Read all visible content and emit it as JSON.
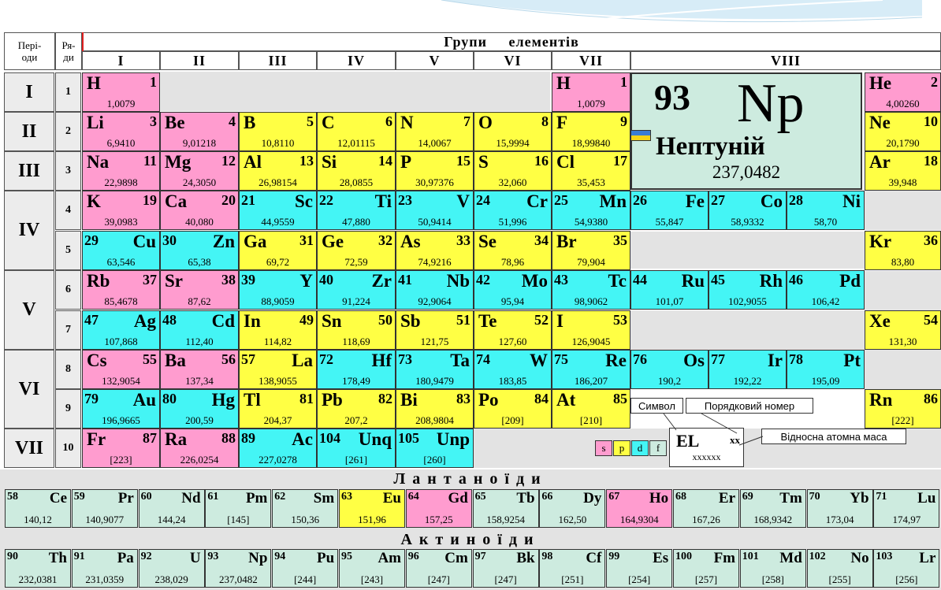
{
  "header": {
    "periods_label": "Пері-\nоди",
    "rows_label": "Ря-\nди",
    "groups_title": "Групи     елементів",
    "groups": [
      "I",
      "II",
      "III",
      "IV",
      "V",
      "VI",
      "VII",
      "VIII"
    ]
  },
  "periods": [
    "I",
    "II",
    "III",
    "IV",
    "V",
    "VI",
    "VII"
  ],
  "rows": [
    "1",
    "2",
    "3",
    "4",
    "5",
    "6",
    "7",
    "8",
    "9",
    "10"
  ],
  "elements": [
    {
      "sym": "H",
      "num": "1",
      "mass": "1,0079",
      "block": "s",
      "col": 1,
      "row": 1,
      "lay": "a"
    },
    {
      "sym": "H",
      "num": "1",
      "mass": "1,0079",
      "block": "s",
      "col": 7,
      "row": 1,
      "lay": "a"
    },
    {
      "sym": "He",
      "num": "2",
      "mass": "4,00260",
      "block": "s",
      "col": 9,
      "row": 1,
      "lay": "a"
    },
    {
      "sym": "Li",
      "num": "3",
      "mass": "6,9410",
      "block": "s",
      "col": 1,
      "row": 2,
      "lay": "a"
    },
    {
      "sym": "Be",
      "num": "4",
      "mass": "9,01218",
      "block": "s",
      "col": 2,
      "row": 2,
      "lay": "a"
    },
    {
      "sym": "B",
      "num": "5",
      "mass": "10,8110",
      "block": "p",
      "col": 3,
      "row": 2,
      "lay": "a"
    },
    {
      "sym": "C",
      "num": "6",
      "mass": "12,01115",
      "block": "p",
      "col": 4,
      "row": 2,
      "lay": "a"
    },
    {
      "sym": "N",
      "num": "7",
      "mass": "14,0067",
      "block": "p",
      "col": 5,
      "row": 2,
      "lay": "a"
    },
    {
      "sym": "O",
      "num": "8",
      "mass": "15,9994",
      "block": "p",
      "col": 6,
      "row": 2,
      "lay": "a"
    },
    {
      "sym": "F",
      "num": "9",
      "mass": "18,99840",
      "block": "p",
      "col": 7,
      "row": 2,
      "lay": "a"
    },
    {
      "sym": "Ne",
      "num": "10",
      "mass": "20,1790",
      "block": "p",
      "col": 9,
      "row": 2,
      "lay": "a"
    },
    {
      "sym": "Na",
      "num": "11",
      "mass": "22,9898",
      "block": "s",
      "col": 1,
      "row": 3,
      "lay": "a"
    },
    {
      "sym": "Mg",
      "num": "12",
      "mass": "24,3050",
      "block": "s",
      "col": 2,
      "row": 3,
      "lay": "a"
    },
    {
      "sym": "Al",
      "num": "13",
      "mass": "26,98154",
      "block": "p",
      "col": 3,
      "row": 3,
      "lay": "a"
    },
    {
      "sym": "Si",
      "num": "14",
      "mass": "28,0855",
      "block": "p",
      "col": 4,
      "row": 3,
      "lay": "a"
    },
    {
      "sym": "P",
      "num": "15",
      "mass": "30,97376",
      "block": "p",
      "col": 5,
      "row": 3,
      "lay": "a"
    },
    {
      "sym": "S",
      "num": "16",
      "mass": "32,060",
      "block": "p",
      "col": 6,
      "row": 3,
      "lay": "a"
    },
    {
      "sym": "Cl",
      "num": "17",
      "mass": "35,453",
      "block": "p",
      "col": 7,
      "row": 3,
      "lay": "a"
    },
    {
      "sym": "Ar",
      "num": "18",
      "mass": "39,948",
      "block": "p",
      "col": 9,
      "row": 3,
      "lay": "a"
    },
    {
      "sym": "K",
      "num": "19",
      "mass": "39,0983",
      "block": "s",
      "col": 1,
      "row": 4,
      "lay": "a"
    },
    {
      "sym": "Ca",
      "num": "20",
      "mass": "40,080",
      "block": "s",
      "col": 2,
      "row": 4,
      "lay": "a"
    },
    {
      "sym": "Sc",
      "num": "21",
      "mass": "44,9559",
      "block": "d",
      "col": 3,
      "row": 4,
      "lay": "b"
    },
    {
      "sym": "Ti",
      "num": "22",
      "mass": "47,880",
      "block": "d",
      "col": 4,
      "row": 4,
      "lay": "b"
    },
    {
      "sym": "V",
      "num": "23",
      "mass": "50,9414",
      "block": "d",
      "col": 5,
      "row": 4,
      "lay": "b"
    },
    {
      "sym": "Cr",
      "num": "24",
      "mass": "51,996",
      "block": "d",
      "col": 6,
      "row": 4,
      "lay": "b"
    },
    {
      "sym": "Mn",
      "num": "25",
      "mass": "54,9380",
      "block": "d",
      "col": 7,
      "row": 4,
      "lay": "b"
    },
    {
      "sym": "Fe",
      "num": "26",
      "mass": "55,847",
      "block": "d",
      "col": 8,
      "row": 4,
      "lay": "b"
    },
    {
      "sym": "Co",
      "num": "27",
      "mass": "58,9332",
      "block": "d",
      "col": 8.5,
      "row": 4,
      "lay": "b"
    },
    {
      "sym": "Ni",
      "num": "28",
      "mass": "58,70",
      "block": "d",
      "col": 8.75,
      "row": 4,
      "lay": "b"
    },
    {
      "sym": "Cu",
      "num": "29",
      "mass": "63,546",
      "block": "d",
      "col": 1,
      "row": 5,
      "lay": "b"
    },
    {
      "sym": "Zn",
      "num": "30",
      "mass": "65,38",
      "block": "d",
      "col": 2,
      "row": 5,
      "lay": "b"
    },
    {
      "sym": "Ga",
      "num": "31",
      "mass": "69,72",
      "block": "p",
      "col": 3,
      "row": 5,
      "lay": "a"
    },
    {
      "sym": "Ge",
      "num": "32",
      "mass": "72,59",
      "block": "p",
      "col": 4,
      "row": 5,
      "lay": "a"
    },
    {
      "sym": "As",
      "num": "33",
      "mass": "74,9216",
      "block": "p",
      "col": 5,
      "row": 5,
      "lay": "a"
    },
    {
      "sym": "Se",
      "num": "34",
      "mass": "78,96",
      "block": "p",
      "col": 6,
      "row": 5,
      "lay": "a"
    },
    {
      "sym": "Br",
      "num": "35",
      "mass": "79,904",
      "block": "p",
      "col": 7,
      "row": 5,
      "lay": "a"
    },
    {
      "sym": "Kr",
      "num": "36",
      "mass": "83,80",
      "block": "p",
      "col": 9,
      "row": 5,
      "lay": "a"
    },
    {
      "sym": "Rb",
      "num": "37",
      "mass": "85,4678",
      "block": "s",
      "col": 1,
      "row": 6,
      "lay": "a"
    },
    {
      "sym": "Sr",
      "num": "38",
      "mass": "87,62",
      "block": "s",
      "col": 2,
      "row": 6,
      "lay": "a"
    },
    {
      "sym": "Y",
      "num": "39",
      "mass": "88,9059",
      "block": "d",
      "col": 3,
      "row": 6,
      "lay": "b"
    },
    {
      "sym": "Zr",
      "num": "40",
      "mass": "91,224",
      "block": "d",
      "col": 4,
      "row": 6,
      "lay": "b"
    },
    {
      "sym": "Nb",
      "num": "41",
      "mass": "92,9064",
      "block": "d",
      "col": 5,
      "row": 6,
      "lay": "b"
    },
    {
      "sym": "Mo",
      "num": "42",
      "mass": "95,94",
      "block": "d",
      "col": 6,
      "row": 6,
      "lay": "b"
    },
    {
      "sym": "Tc",
      "num": "43",
      "mass": "98,9062",
      "block": "d",
      "col": 7,
      "row": 6,
      "lay": "b"
    },
    {
      "sym": "Ru",
      "num": "44",
      "mass": "101,07",
      "block": "d",
      "col": 8,
      "row": 6,
      "lay": "b"
    },
    {
      "sym": "Rh",
      "num": "45",
      "mass": "102,9055",
      "block": "d",
      "col": 8.5,
      "row": 6,
      "lay": "b"
    },
    {
      "sym": "Pd",
      "num": "46",
      "mass": "106,42",
      "block": "d",
      "col": 8.75,
      "row": 6,
      "lay": "b"
    },
    {
      "sym": "Ag",
      "num": "47",
      "mass": "107,868",
      "block": "d",
      "col": 1,
      "row": 7,
      "lay": "b"
    },
    {
      "sym": "Cd",
      "num": "48",
      "mass": "112,40",
      "block": "d",
      "col": 2,
      "row": 7,
      "lay": "b"
    },
    {
      "sym": "In",
      "num": "49",
      "mass": "114,82",
      "block": "p",
      "col": 3,
      "row": 7,
      "lay": "a"
    },
    {
      "sym": "Sn",
      "num": "50",
      "mass": "118,69",
      "block": "p",
      "col": 4,
      "row": 7,
      "lay": "a"
    },
    {
      "sym": "Sb",
      "num": "51",
      "mass": "121,75",
      "block": "p",
      "col": 5,
      "row": 7,
      "lay": "a"
    },
    {
      "sym": "Te",
      "num": "52",
      "mass": "127,60",
      "block": "p",
      "col": 6,
      "row": 7,
      "lay": "a"
    },
    {
      "sym": "I",
      "num": "53",
      "mass": "126,9045",
      "block": "p",
      "col": 7,
      "row": 7,
      "lay": "a"
    },
    {
      "sym": "Xe",
      "num": "54",
      "mass": "131,30",
      "block": "p",
      "col": 9,
      "row": 7,
      "lay": "a"
    },
    {
      "sym": "Cs",
      "num": "55",
      "mass": "132,9054",
      "block": "s",
      "col": 1,
      "row": 8,
      "lay": "a"
    },
    {
      "sym": "Ba",
      "num": "56",
      "mass": "137,34",
      "block": "s",
      "col": 2,
      "row": 8,
      "lay": "a"
    },
    {
      "sym": "La",
      "num": "57",
      "mass": "138,9055",
      "block": "p",
      "col": 3,
      "row": 8,
      "lay": "b"
    },
    {
      "sym": "Hf",
      "num": "72",
      "mass": "178,49",
      "block": "d",
      "col": 4,
      "row": 8,
      "lay": "b"
    },
    {
      "sym": "Ta",
      "num": "73",
      "mass": "180,9479",
      "block": "d",
      "col": 5,
      "row": 8,
      "lay": "b"
    },
    {
      "sym": "W",
      "num": "74",
      "mass": "183,85",
      "block": "d",
      "col": 6,
      "row": 8,
      "lay": "b"
    },
    {
      "sym": "Re",
      "num": "75",
      "mass": "186,207",
      "block": "d",
      "col": 7,
      "row": 8,
      "lay": "b"
    },
    {
      "sym": "Os",
      "num": "76",
      "mass": "190,2",
      "block": "d",
      "col": 8,
      "row": 8,
      "lay": "b"
    },
    {
      "sym": "Ir",
      "num": "77",
      "mass": "192,22",
      "block": "d",
      "col": 8.5,
      "row": 8,
      "lay": "b"
    },
    {
      "sym": "Pt",
      "num": "78",
      "mass": "195,09",
      "block": "d",
      "col": 8.75,
      "row": 8,
      "lay": "b"
    },
    {
      "sym": "Au",
      "num": "79",
      "mass": "196,9665",
      "block": "d",
      "col": 1,
      "row": 9,
      "lay": "b"
    },
    {
      "sym": "Hg",
      "num": "80",
      "mass": "200,59",
      "block": "d",
      "col": 2,
      "row": 9,
      "lay": "b"
    },
    {
      "sym": "Tl",
      "num": "81",
      "mass": "204,37",
      "block": "p",
      "col": 3,
      "row": 9,
      "lay": "a"
    },
    {
      "sym": "Pb",
      "num": "82",
      "mass": "207,2",
      "block": "p",
      "col": 4,
      "row": 9,
      "lay": "a"
    },
    {
      "sym": "Bi",
      "num": "83",
      "mass": "208,9804",
      "block": "p",
      "col": 5,
      "row": 9,
      "lay": "a"
    },
    {
      "sym": "Po",
      "num": "84",
      "mass": "[209]",
      "block": "p",
      "col": 6,
      "row": 9,
      "lay": "a"
    },
    {
      "sym": "At",
      "num": "85",
      "mass": "[210]",
      "block": "p",
      "col": 7,
      "row": 9,
      "lay": "a"
    },
    {
      "sym": "Rn",
      "num": "86",
      "mass": "[222]",
      "block": "p",
      "col": 9,
      "row": 9,
      "lay": "a"
    },
    {
      "sym": "Fr",
      "num": "87",
      "mass": "[223]",
      "block": "s",
      "col": 1,
      "row": 10,
      "lay": "a"
    },
    {
      "sym": "Ra",
      "num": "88",
      "mass": "226,0254",
      "block": "s",
      "col": 2,
      "row": 10,
      "lay": "a"
    },
    {
      "sym": "Ac",
      "num": "89",
      "mass": "227,0278",
      "block": "d",
      "col": 3,
      "row": 10,
      "lay": "b"
    },
    {
      "sym": "Unq",
      "num": "104",
      "mass": "[261]",
      "block": "d",
      "col": 4,
      "row": 10,
      "lay": "b"
    },
    {
      "sym": "Unp",
      "num": "105",
      "mass": "[260]",
      "block": "d",
      "col": 5,
      "row": 10,
      "lay": "b"
    }
  ],
  "featured": {
    "num": "93",
    "sym": "Np",
    "name": "Нептуній",
    "mass": "237,0482"
  },
  "legend": {
    "symbol_label": "Символ",
    "number_label": "Порядковий номер",
    "mass_label": "Відносна атомна маса",
    "key_symbol": "EL",
    "key_number": "xx",
    "key_mass": "xxxxxx",
    "blocks": [
      "s",
      "p",
      "d",
      "f"
    ]
  },
  "lanthanides": {
    "title": "Лантаноїди",
    "items": [
      {
        "sym": "Ce",
        "num": "58",
        "mass": "140,12",
        "block": "f"
      },
      {
        "sym": "Pr",
        "num": "59",
        "mass": "140,9077",
        "block": "f"
      },
      {
        "sym": "Nd",
        "num": "60",
        "mass": "144,24",
        "block": "f"
      },
      {
        "sym": "Pm",
        "num": "61",
        "mass": "[145]",
        "block": "f"
      },
      {
        "sym": "Sm",
        "num": "62",
        "mass": "150,36",
        "block": "f"
      },
      {
        "sym": "Eu",
        "num": "63",
        "mass": "151,96",
        "block": "nm"
      },
      {
        "sym": "Gd",
        "num": "64",
        "mass": "157,25",
        "block": "s"
      },
      {
        "sym": "Tb",
        "num": "65",
        "mass": "158,9254",
        "block": "f"
      },
      {
        "sym": "Dy",
        "num": "66",
        "mass": "162,50",
        "block": "f"
      },
      {
        "sym": "Ho",
        "num": "67",
        "mass": "164,9304",
        "block": "s"
      },
      {
        "sym": "Er",
        "num": "68",
        "mass": "167,26",
        "block": "f"
      },
      {
        "sym": "Tm",
        "num": "69",
        "mass": "168,9342",
        "block": "f"
      },
      {
        "sym": "Yb",
        "num": "70",
        "mass": "173,04",
        "block": "f"
      },
      {
        "sym": "Lu",
        "num": "71",
        "mass": "174,97",
        "block": "f"
      }
    ]
  },
  "actinides": {
    "title": "Актиноїди",
    "items": [
      {
        "sym": "Th",
        "num": "90",
        "mass": "232,0381",
        "block": "f"
      },
      {
        "sym": "Pa",
        "num": "91",
        "mass": "231,0359",
        "block": "f"
      },
      {
        "sym": "U",
        "num": "92",
        "mass": "238,029",
        "block": "f"
      },
      {
        "sym": "Np",
        "num": "93",
        "mass": "237,0482",
        "block": "f"
      },
      {
        "sym": "Pu",
        "num": "94",
        "mass": "[244]",
        "block": "f"
      },
      {
        "sym": "Am",
        "num": "95",
        "mass": "[243]",
        "block": "f"
      },
      {
        "sym": "Cm",
        "num": "96",
        "mass": "[247]",
        "block": "f"
      },
      {
        "sym": "Bk",
        "num": "97",
        "mass": "[247]",
        "block": "f"
      },
      {
        "sym": "Cf",
        "num": "98",
        "mass": "[251]",
        "block": "f"
      },
      {
        "sym": "Es",
        "num": "99",
        "mass": "[254]",
        "block": "f"
      },
      {
        "sym": "Fm",
        "num": "100",
        "mass": "[257]",
        "block": "f"
      },
      {
        "sym": "Md",
        "num": "101",
        "mass": "[258]",
        "block": "f"
      },
      {
        "sym": "No",
        "num": "102",
        "mass": "[255]",
        "block": "f"
      },
      {
        "sym": "Lr",
        "num": "103",
        "mass": "[256]",
        "block": "f"
      }
    ]
  },
  "colors": {
    "s_block": "#ff9ccf",
    "p_block": "#ffff44",
    "d_block": "#44f5f5",
    "f_block": "#cdebdf",
    "highlight_line": "#e02020"
  }
}
